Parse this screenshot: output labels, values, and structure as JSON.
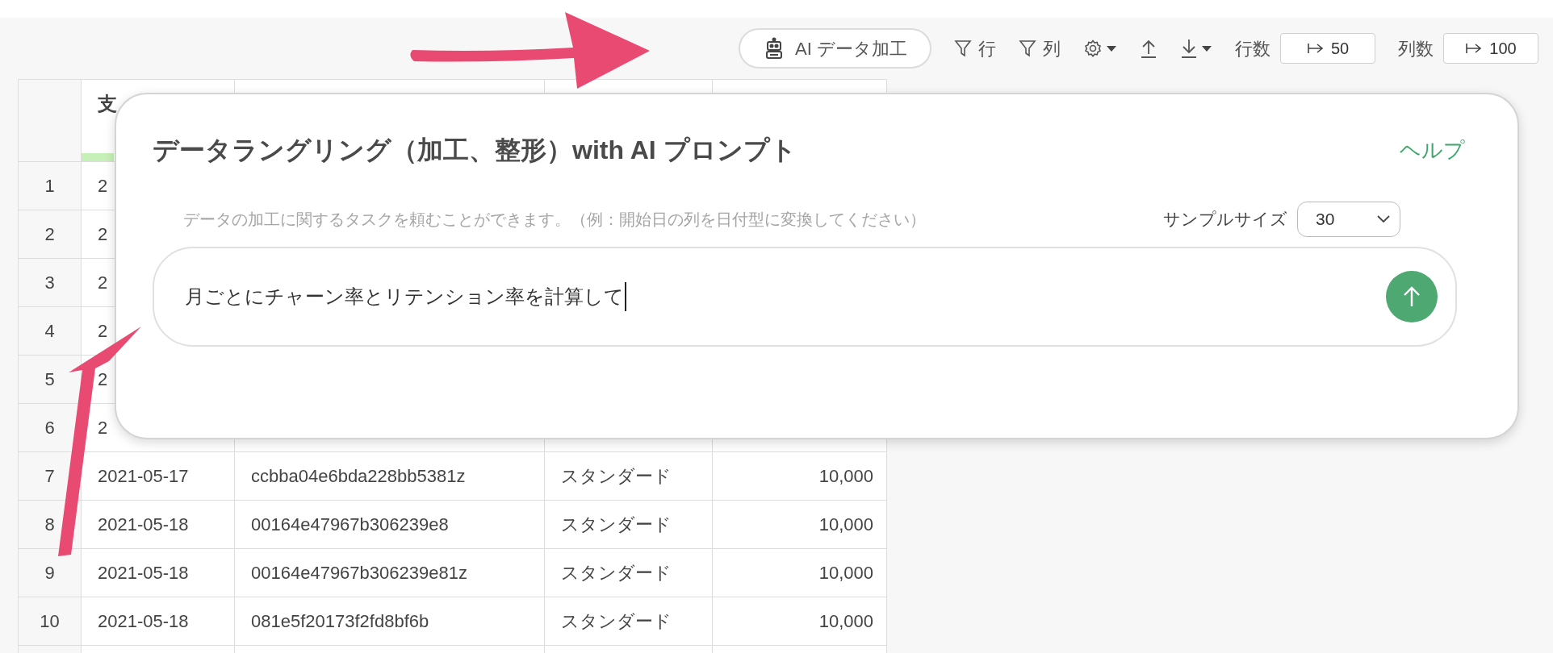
{
  "toolbar": {
    "ai_button": "AI データ加工",
    "row_filter": "行",
    "column_filter": "列",
    "row_count_label": "行数",
    "row_count_value": "50",
    "column_count_label": "列数",
    "column_count_value": "100"
  },
  "table": {
    "header": [
      "支"
    ],
    "rows": [
      {
        "index": "1",
        "cells": [
          "2"
        ]
      },
      {
        "index": "2",
        "cells": [
          "2"
        ]
      },
      {
        "index": "3",
        "cells": [
          "2"
        ]
      },
      {
        "index": "4",
        "cells": [
          "2"
        ]
      },
      {
        "index": "5",
        "cells": [
          "2"
        ]
      },
      {
        "index": "6",
        "cells": [
          "2"
        ]
      },
      {
        "index": "7",
        "cells": [
          "2021-05-17",
          "ccbba04e6bda228bb5381z",
          "スタンダード",
          "10,000"
        ]
      },
      {
        "index": "8",
        "cells": [
          "2021-05-18",
          "00164e47967b306239e8",
          "スタンダード",
          "10,000"
        ]
      },
      {
        "index": "9",
        "cells": [
          "2021-05-18",
          "00164e47967b306239e81z",
          "スタンダード",
          "10,000"
        ]
      },
      {
        "index": "10",
        "cells": [
          "2021-05-18",
          "081e5f20173f2fd8bf6b",
          "スタンダード",
          "10,000"
        ]
      }
    ]
  },
  "dialog": {
    "title": "データラングリング（加工、整形）with AI プロンプト",
    "help_link": "ヘルプ",
    "hint": "データの加工に関するタスクを頼むことができます。（例：開始日の列を日付型に変換してください）",
    "sample_size_label": "サンプルサイズ",
    "sample_size": "30",
    "prompt": "月ごとにチャーン率とリテンション率を計算して"
  }
}
